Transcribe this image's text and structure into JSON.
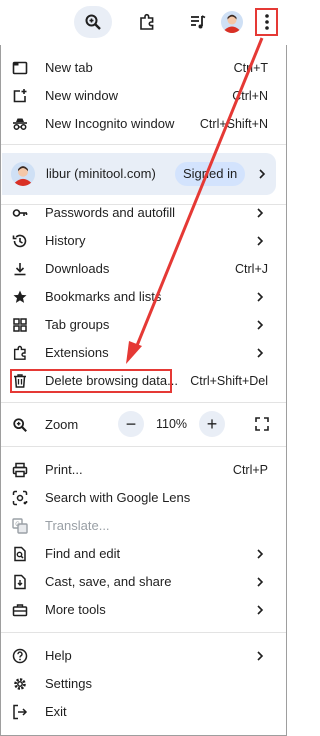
{
  "menu": {
    "new_tab": {
      "label": "New tab",
      "shortcut": "Ctrl+T"
    },
    "new_window": {
      "label": "New window",
      "shortcut": "Ctrl+N"
    },
    "new_incognito": {
      "label": "New Incognito window",
      "shortcut": "Ctrl+Shift+N"
    },
    "profile": {
      "name": "libur (minitool.com)",
      "status": "Signed in"
    },
    "passwords": {
      "label": "Passwords and autofill"
    },
    "history": {
      "label": "History"
    },
    "downloads": {
      "label": "Downloads",
      "shortcut": "Ctrl+J"
    },
    "bookmarks": {
      "label": "Bookmarks and lists"
    },
    "tab_groups": {
      "label": "Tab groups"
    },
    "extensions": {
      "label": "Extensions"
    },
    "delete_data": {
      "label": "Delete browsing data...",
      "shortcut": "Ctrl+Shift+Del"
    },
    "zoom": {
      "label": "Zoom",
      "minus": "−",
      "value": "110%",
      "plus": "+"
    },
    "print": {
      "label": "Print...",
      "shortcut": "Ctrl+P"
    },
    "google_lens": {
      "label": "Search with Google Lens"
    },
    "translate": {
      "label": "Translate..."
    },
    "find_edit": {
      "label": "Find and edit"
    },
    "cast_save": {
      "label": "Cast, save, and share"
    },
    "more_tools": {
      "label": "More tools"
    },
    "help": {
      "label": "Help"
    },
    "settings": {
      "label": "Settings"
    },
    "exit": {
      "label": "Exit"
    }
  },
  "colors": {
    "annotation": "#e53935",
    "signed_pill": "#d3e3fd",
    "profile_bg": "#e8eef7"
  }
}
